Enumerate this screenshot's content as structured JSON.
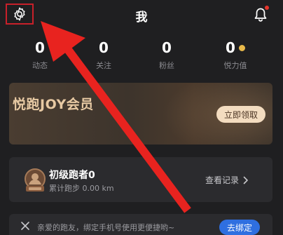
{
  "header": {
    "title": "我",
    "settings_icon": "gear-icon",
    "bell_icon": "bell-icon",
    "bell_dot_color": "#e5352b"
  },
  "stats": [
    {
      "value": "0",
      "label": "动态"
    },
    {
      "value": "0",
      "label": "关注"
    },
    {
      "value": "0",
      "label": "粉丝"
    },
    {
      "value": "0",
      "label": "悦力值"
    }
  ],
  "membership": {
    "title": "悦跑JOY会员",
    "claim_label": "立即领取"
  },
  "runner": {
    "level": "初级跑者0",
    "subtitle": "累计跑步 0.00 km",
    "records_label": "查看记录",
    "badge_icon": "runner-badge-icon"
  },
  "bind_bar": {
    "text": "亲爱的跑友，绑定手机号使用更便捷哟~",
    "button_label": "去绑定",
    "close_icon": "close-icon"
  },
  "colors": {
    "background": "#1f1f21",
    "card": "#2b2b2e",
    "accent_gold": "#e7c9a3",
    "accent_blue": "#2f6fe0",
    "annotation_red": "#e8231f"
  }
}
